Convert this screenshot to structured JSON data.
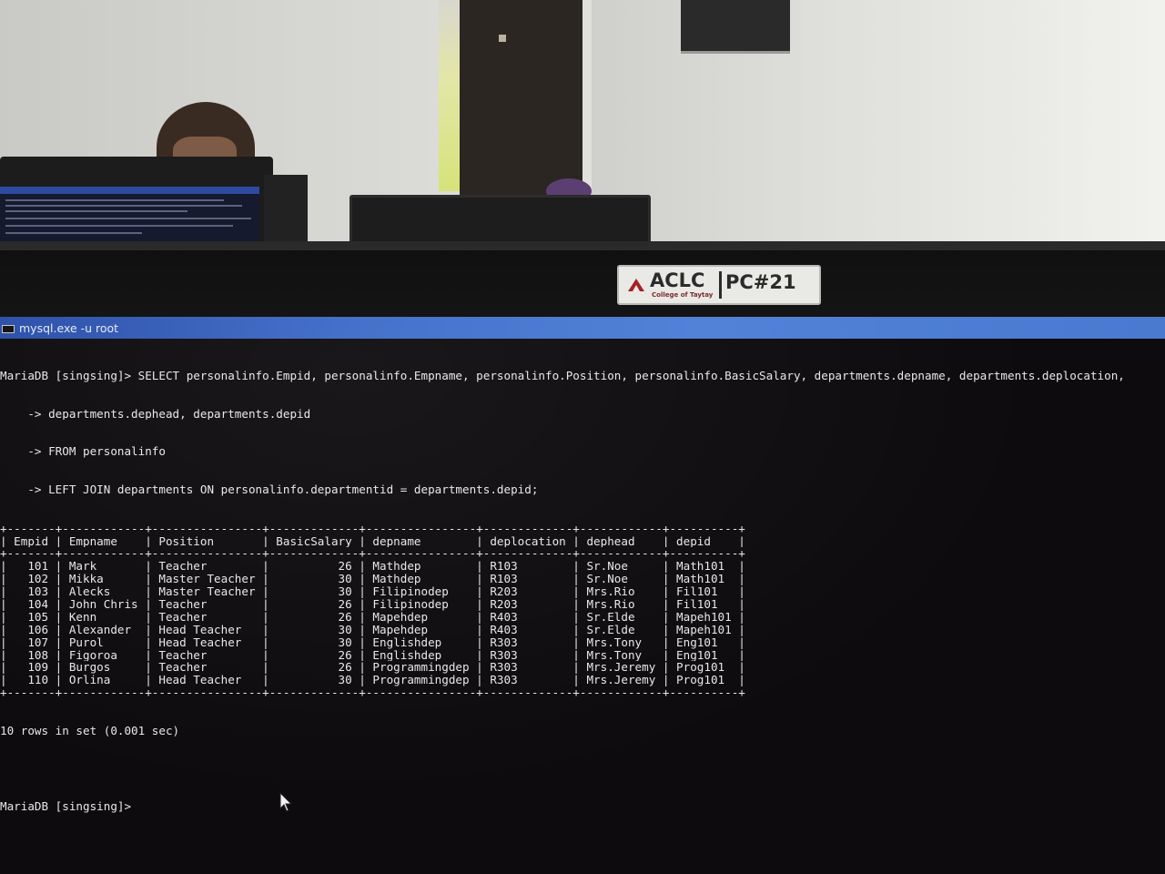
{
  "window": {
    "title": "mysql.exe  -u root"
  },
  "console": {
    "command_lines": [
      "MariaDB [singsing]> SELECT personalinfo.Empid, personalinfo.Empname, personalinfo.Position, personalinfo.BasicSalary, departments.depname, departments.deplocation,",
      "    -> departments.dephead, departments.depid",
      "    -> FROM personalinfo",
      "    -> LEFT JOIN departments ON personalinfo.departmentid = departments.depid;"
    ],
    "result_table": {
      "columns": [
        "Empid",
        "Empname",
        "Position",
        "BasicSalary",
        "depname",
        "deplocation",
        "dephead",
        "depid"
      ],
      "rows": [
        [
          "101",
          "Mark",
          "Teacher",
          "26",
          "Mathdep",
          "R103",
          "Sr.Noe",
          "Math101"
        ],
        [
          "102",
          "Mikka",
          "Master Teacher",
          "30",
          "Mathdep",
          "R103",
          "Sr.Noe",
          "Math101"
        ],
        [
          "103",
          "Alecks",
          "Master Teacher",
          "30",
          "Filipinodep",
          "R203",
          "Mrs.Rio",
          "Fil101"
        ],
        [
          "104",
          "John Chris",
          "Teacher",
          "26",
          "Filipinodep",
          "R203",
          "Mrs.Rio",
          "Fil101"
        ],
        [
          "105",
          "Kenn",
          "Teacher",
          "26",
          "Mapehdep",
          "R403",
          "Sr.Elde",
          "Mapeh101"
        ],
        [
          "106",
          "Alexander",
          "Head Teacher",
          "30",
          "Mapehdep",
          "R403",
          "Sr.Elde",
          "Mapeh101"
        ],
        [
          "107",
          "Purol",
          "Head Teacher",
          "30",
          "Englishdep",
          "R303",
          "Mrs.Tony",
          "Eng101"
        ],
        [
          "108",
          "Figoroa",
          "Teacher",
          "26",
          "Englishdep",
          "R303",
          "Mrs.Tony",
          "Eng101"
        ],
        [
          "109",
          "Burgos",
          "Teacher",
          "26",
          "Programmingdep",
          "R303",
          "Mrs.Jeremy",
          "Prog101"
        ],
        [
          "110",
          "Orlina",
          "Head Teacher",
          "30",
          "Programmingdep",
          "R303",
          "Mrs.Jeremy",
          "Prog101"
        ]
      ]
    },
    "result_summary": "10 rows in set (0.001 sec)",
    "prompt": "MariaDB [singsing]>"
  },
  "monitor_sticker": {
    "brand": "ACLC",
    "subtitle": "College of Taytay",
    "pc_label": "PC#21"
  },
  "colors": {
    "console_bg": "#0d0b0d",
    "console_text": "#e8e8ea",
    "titlebar": "#3c6ac7"
  },
  "icons": {
    "window_icon": "console-icon",
    "sticker_logo": "aclc-logo-icon",
    "mouse_pointer": "cursor-arrow-icon"
  }
}
